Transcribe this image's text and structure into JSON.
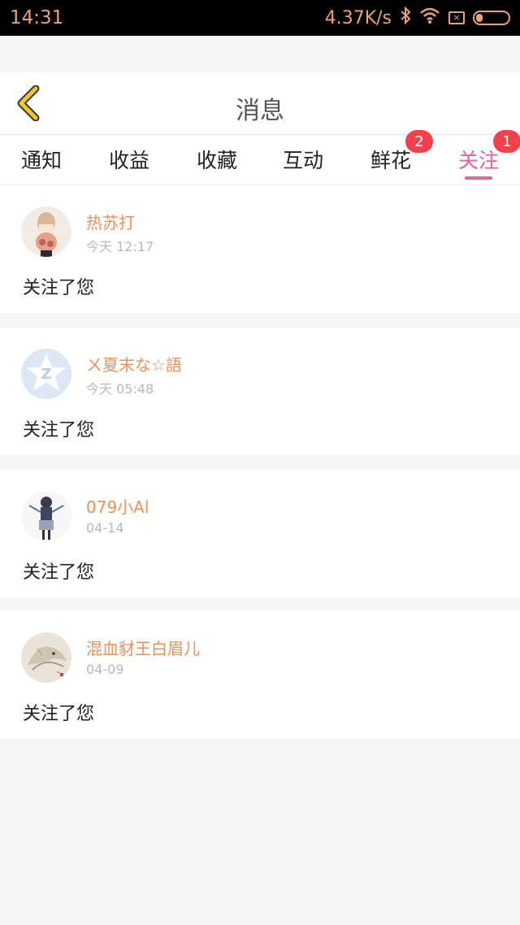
{
  "status_bar": {
    "time": "14:31",
    "net_speed": "4.37K/s",
    "icons": [
      "bluetooth-icon",
      "wifi-icon",
      "sim-icon",
      "battery-icon"
    ]
  },
  "header": {
    "title": "消息",
    "back_icon": "chevron-left-icon"
  },
  "tabs": [
    {
      "label": "通知",
      "badge": ""
    },
    {
      "label": "收益",
      "badge": ""
    },
    {
      "label": "收藏",
      "badge": ""
    },
    {
      "label": "互动",
      "badge": ""
    },
    {
      "label": "鲜花",
      "badge": "2"
    },
    {
      "label": "关注",
      "badge": "1",
      "active": true
    }
  ],
  "feed": [
    {
      "user": "热苏打",
      "time": "今天 12:17",
      "message": "关注了您",
      "avatar": "avatar-illustration"
    },
    {
      "user": "ㄨ夏末な☆語",
      "time": "今天 05:48",
      "message": "关注了您",
      "avatar": "qq-default-avatar"
    },
    {
      "user": "079小Al",
      "time": "04-14",
      "message": "关注了您",
      "avatar": "avatar-anime-figure"
    },
    {
      "user": "混血豺王白眉儿",
      "time": "04-09",
      "message": "关注了您",
      "avatar": "avatar-wolf-painting"
    }
  ],
  "colors": {
    "accent": "#e8619b",
    "username": "#e8925e",
    "badge": "#f2404c",
    "back_arrow": "#f4c430"
  }
}
